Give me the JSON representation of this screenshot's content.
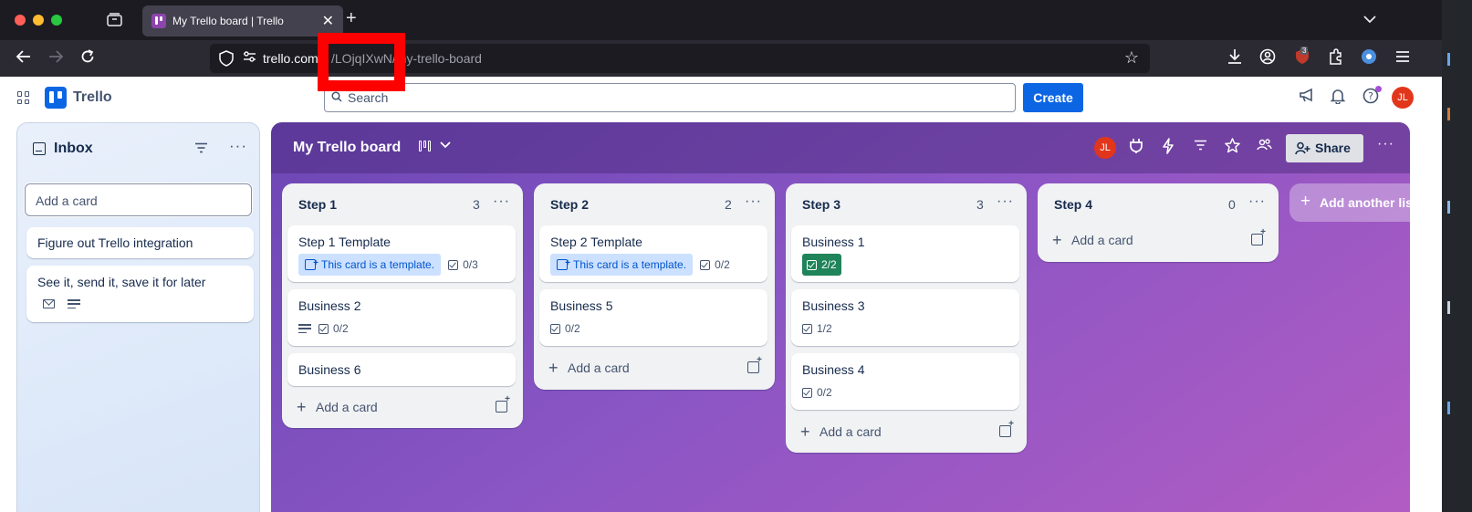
{
  "browser": {
    "tab_title": "My Trello board | Trello",
    "tab_close": "✕",
    "new_tab": "+",
    "url_domain": "trello.com",
    "url_path": "/LOjqIXwN/my-trello-board",
    "extension_badge": "3"
  },
  "trello": {
    "logo": "Trello",
    "search_placeholder": "Search",
    "create_label": "Create",
    "avatar_initials": "JL"
  },
  "inbox": {
    "title": "Inbox",
    "add_card_placeholder": "Add a card",
    "cards": [
      {
        "title": "Figure out Trello integration"
      },
      {
        "title": "See it, send it, save it for later"
      }
    ]
  },
  "board": {
    "title": "My Trello board",
    "share_label": "Share",
    "member_initials": "JL",
    "add_list_label": "Add another list",
    "add_card_label": "Add a card",
    "lists": [
      {
        "title": "Step 1",
        "count": "3",
        "cards": [
          {
            "title": "Step 1 Template",
            "template": "This card is a template.",
            "checklist": "0/3"
          },
          {
            "title": "Business 2",
            "checklist": "0/2"
          },
          {
            "title": "Business 6"
          }
        ]
      },
      {
        "title": "Step 2",
        "count": "2",
        "cards": [
          {
            "title": "Step 2 Template",
            "template": "This card is a template.",
            "checklist": "0/2"
          },
          {
            "title": "Business 5",
            "checklist": "0/2"
          }
        ]
      },
      {
        "title": "Step 3",
        "count": "3",
        "cards": [
          {
            "title": "Business 1",
            "checklist": "2/2"
          },
          {
            "title": "Business 3",
            "checklist": "1/2"
          },
          {
            "title": "Business 4",
            "checklist": "0/2"
          }
        ]
      },
      {
        "title": "Step 4",
        "count": "0",
        "cards": []
      }
    ]
  },
  "colors": {
    "board_start": "#6c47b5",
    "board_end": "#b25cc3",
    "create_blue": "#0c66e4",
    "template_badge": "#cce0ff",
    "checklist_complete": "#1f845a",
    "avatar_red": "#e2361c",
    "redaction_red": "#ff0000"
  },
  "icons": [
    "apps-grid-icon",
    "trello-logo-icon",
    "search-icon",
    "megaphone-icon",
    "bell-icon",
    "help-icon",
    "inbox-icon",
    "filter-icon",
    "more-icon",
    "board-view-icon",
    "chevron-down-icon",
    "power-up-icon",
    "automation-icon",
    "star-icon",
    "members-icon",
    "share-icon",
    "checklist-icon",
    "template-icon",
    "description-icon",
    "email-icon",
    "plus-icon"
  ]
}
